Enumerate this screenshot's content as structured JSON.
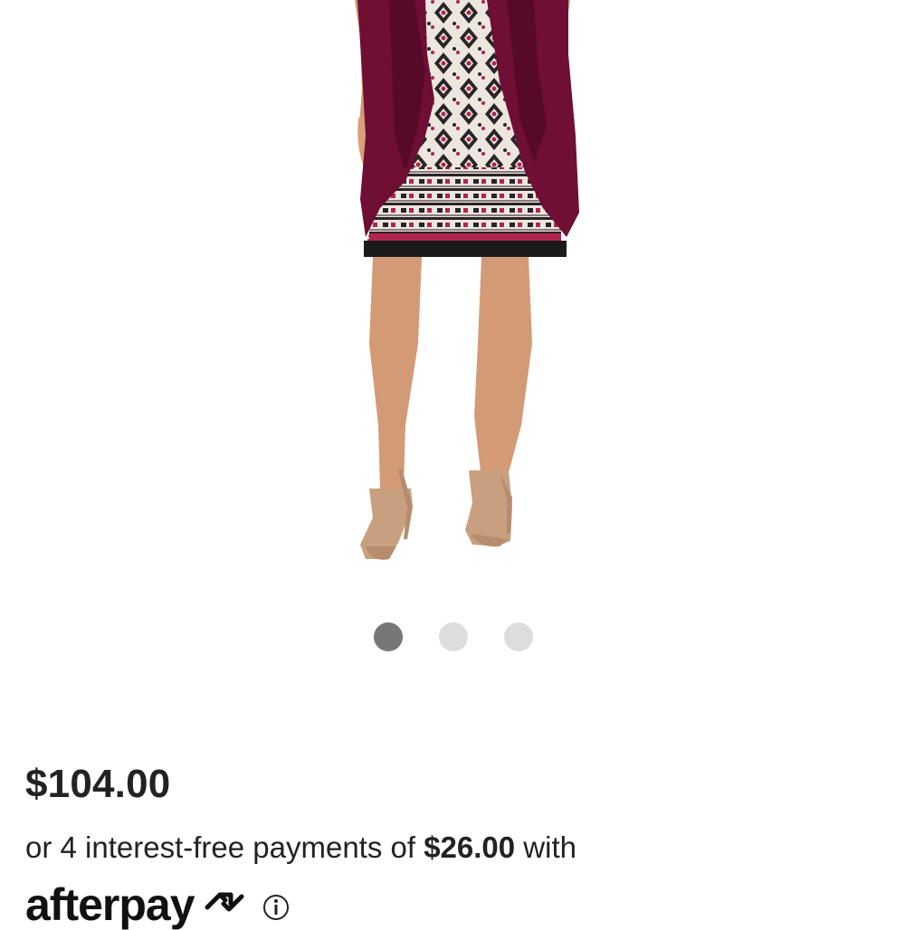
{
  "product": {
    "image_alt": "Woman wearing a wine cardigan over a printed dress with nude strappy sandals",
    "colors": {
      "cardigan": "#6e0f33",
      "skin": "#d9a07a",
      "print_dark": "#2b2426",
      "print_light": "#ece6df",
      "print_accent": "#b0254f"
    }
  },
  "carousel": {
    "slide_count": 3,
    "active_index": 0,
    "colors": {
      "active": "#777777",
      "inactive": "#dddddd"
    }
  },
  "pricing": {
    "price": "$104.00",
    "installments_prefix": "or 4 interest-free payments of ",
    "installment_amount": "$26.00",
    "installments_suffix": " with",
    "provider": "afterpay",
    "info_icon": "info-icon"
  }
}
